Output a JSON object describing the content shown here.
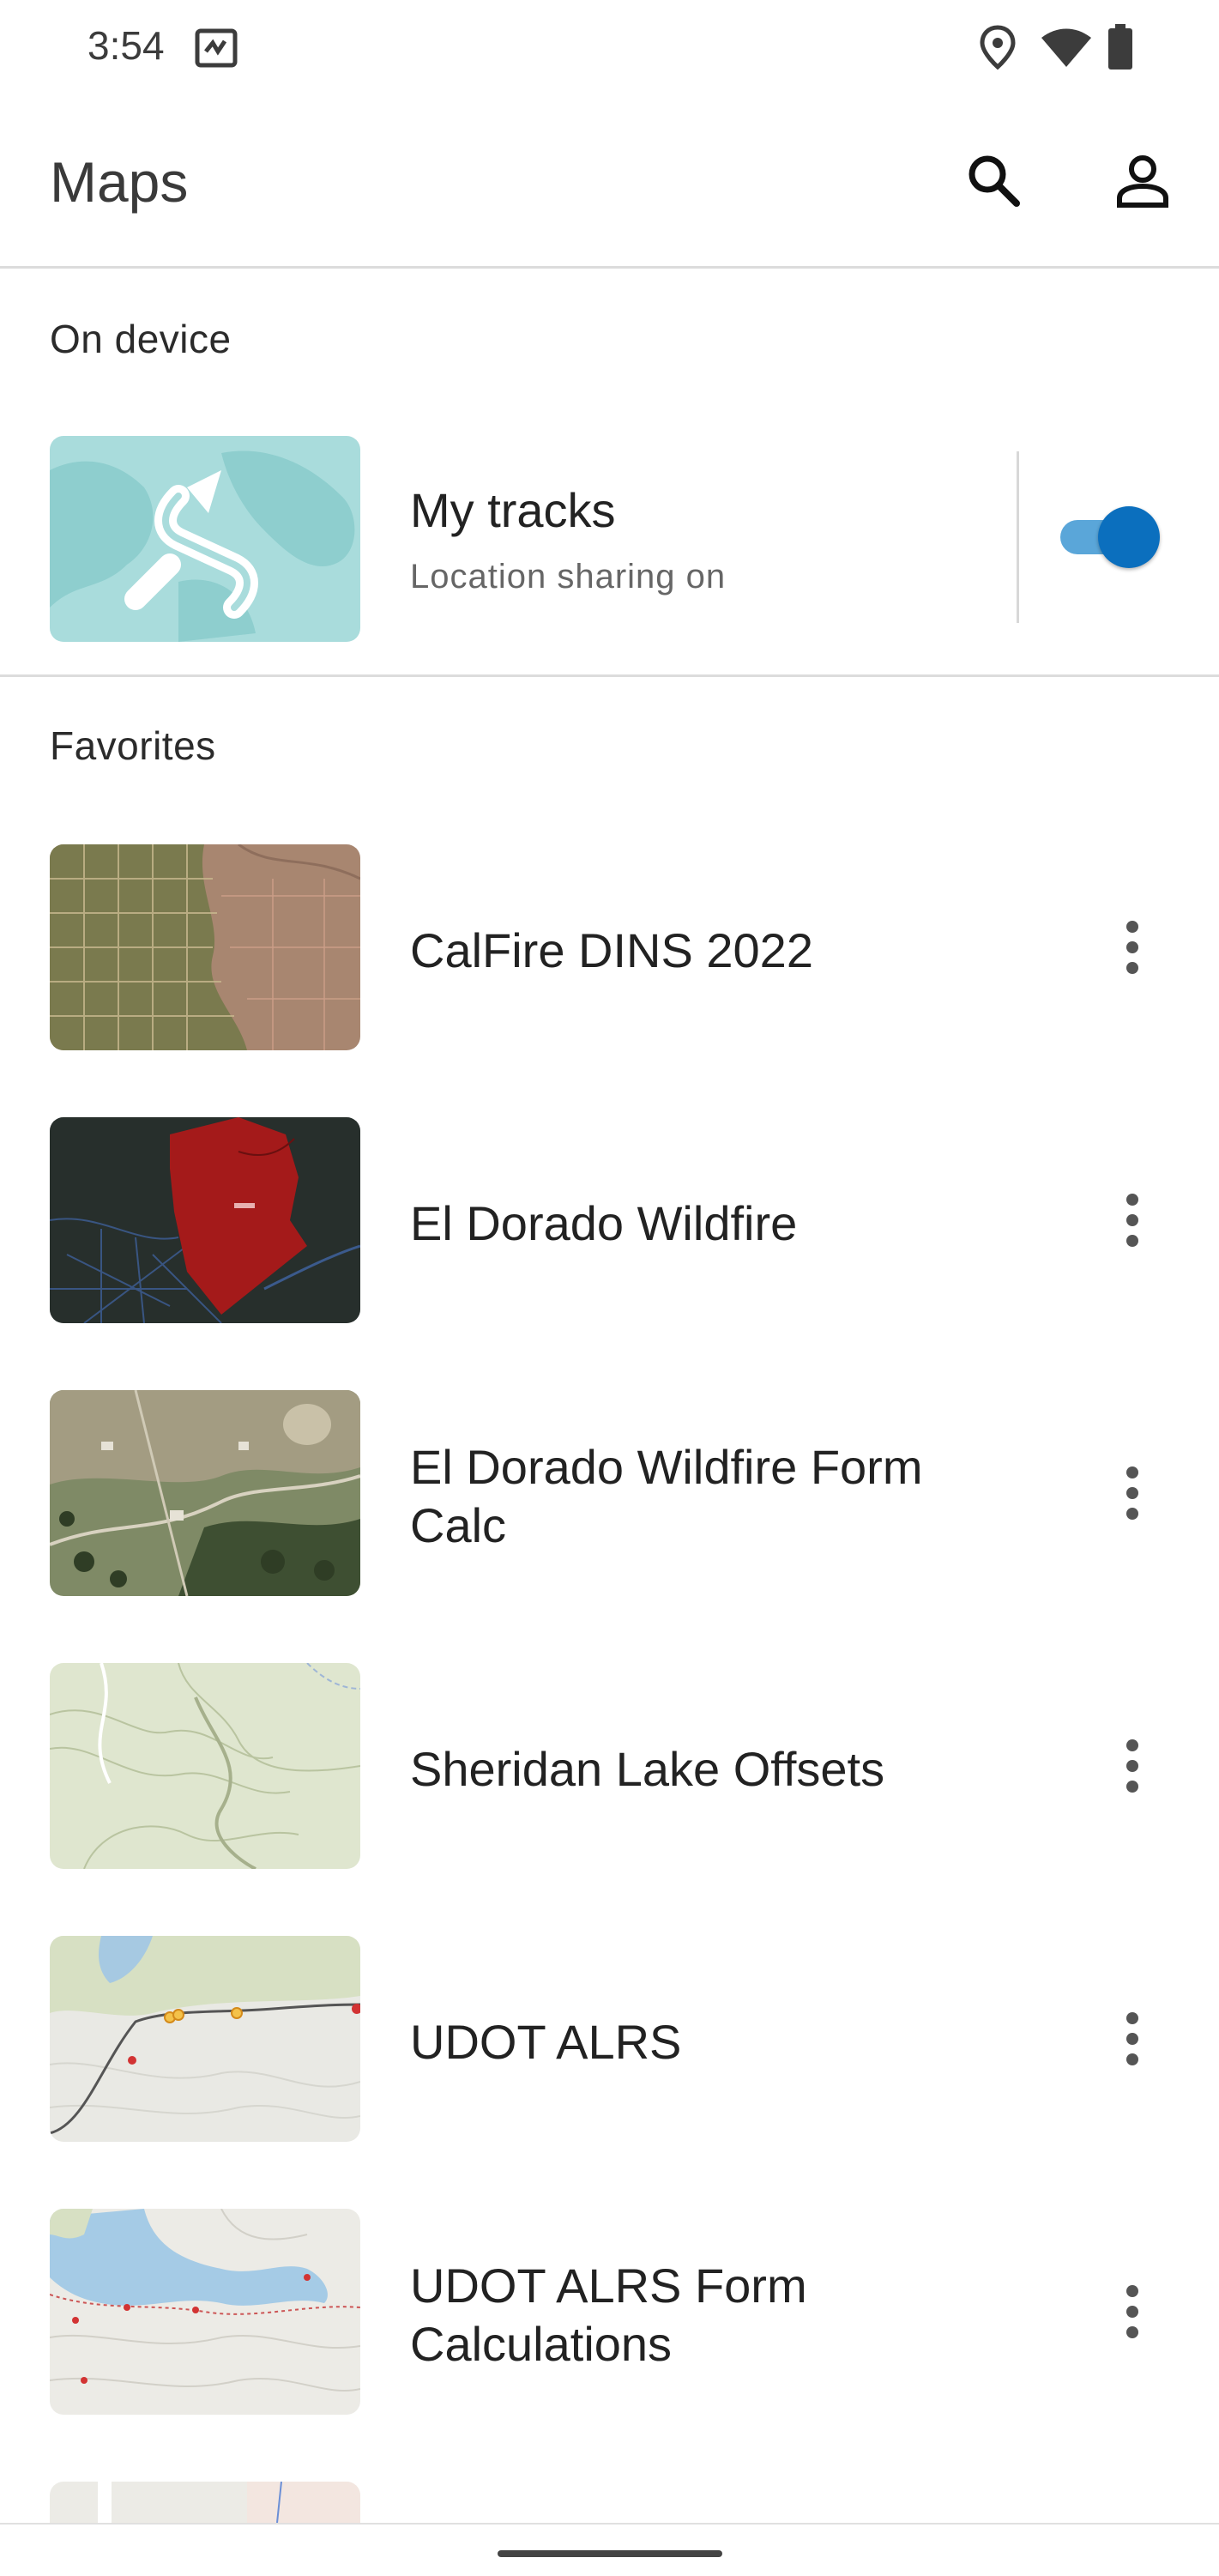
{
  "status_bar": {
    "time": "3:54",
    "icons": [
      "app-notification-icon",
      "location-icon",
      "wifi-icon",
      "battery-icon"
    ]
  },
  "app_bar": {
    "title": "Maps",
    "actions": [
      "search-icon",
      "account-icon"
    ]
  },
  "sections": {
    "on_device": "On device",
    "favorites": "Favorites"
  },
  "my_tracks": {
    "title": "My tracks",
    "subtitle": "Location sharing on",
    "toggle_on": true,
    "accent_color": "#0b6fbe"
  },
  "favorites": [
    {
      "title": "CalFire DINS 2022",
      "thumbnail": "satellite-parcels"
    },
    {
      "title": "El Dorado Wildfire",
      "thumbnail": "dark-fire-perimeter"
    },
    {
      "title": "El Dorado Wildfire Form Calc",
      "thumbnail": "satellite-imagery"
    },
    {
      "title": "Sheridan Lake Offsets",
      "thumbnail": "topographic"
    },
    {
      "title": "UDOT ALRS",
      "thumbnail": "topo-road"
    },
    {
      "title": "UDOT ALRS Form Calculations",
      "thumbnail": "topo-lake"
    }
  ]
}
